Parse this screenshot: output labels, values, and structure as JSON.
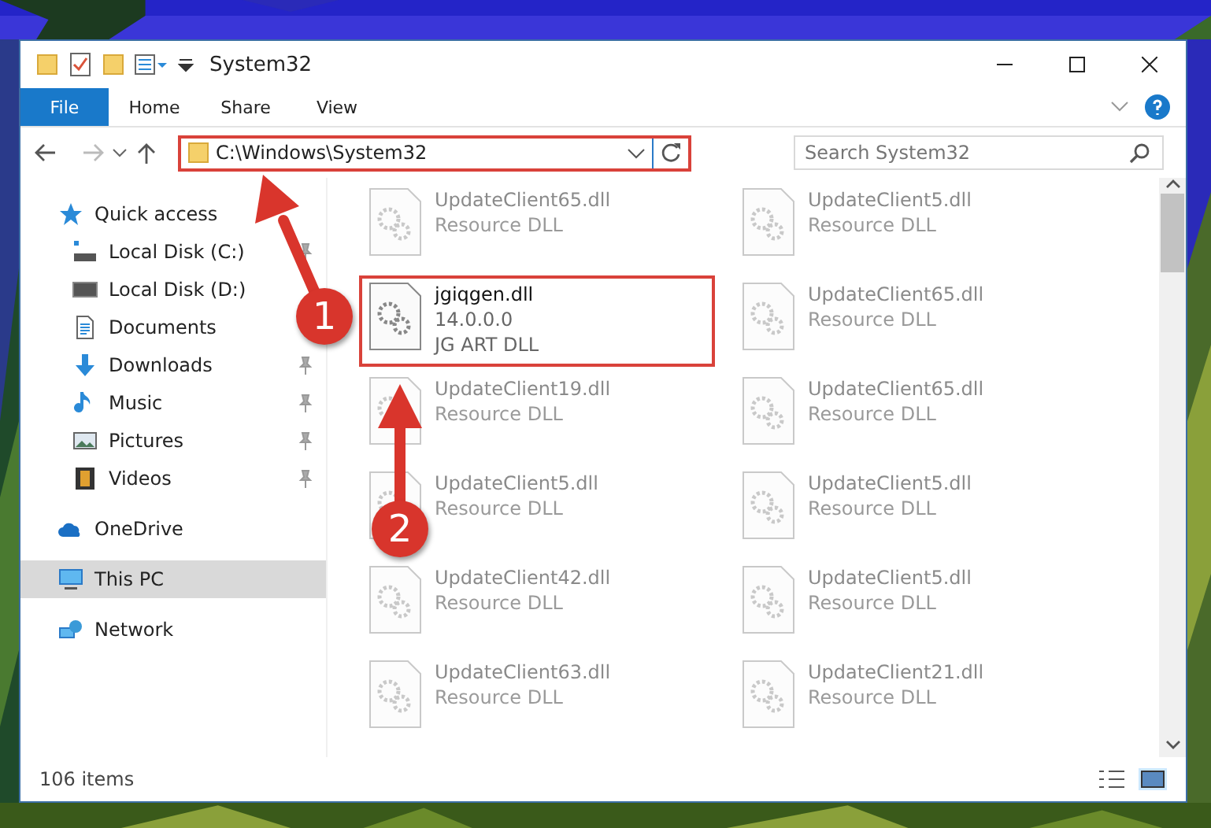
{
  "window": {
    "title": "System32"
  },
  "ribbon_tabs": [
    {
      "label": "File",
      "kind": "file",
      "selected": false
    },
    {
      "label": "Home",
      "kind": "tab",
      "selected": false
    },
    {
      "label": "Share",
      "kind": "tab",
      "selected": false
    },
    {
      "label": "View",
      "kind": "tab",
      "selected": false
    }
  ],
  "address_bar": {
    "path": "C:\\Windows\\System32",
    "highlighted": true
  },
  "search": {
    "placeholder": "Search System32"
  },
  "sidebar": {
    "groups": [
      {
        "label": "Quick access",
        "kind": "star",
        "selected": false,
        "children": [
          {
            "label": "Local Disk (C:)",
            "kind": "drive-c",
            "pinned": true,
            "selected": false
          },
          {
            "label": "Local Disk (D:)",
            "kind": "drive",
            "pinned": false,
            "selected": false
          },
          {
            "label": "Documents",
            "kind": "documents",
            "pinned": false,
            "selected": false
          },
          {
            "label": "Downloads",
            "kind": "downloads",
            "pinned": true,
            "selected": false
          },
          {
            "label": "Music",
            "kind": "music",
            "pinned": true,
            "selected": false
          },
          {
            "label": "Pictures",
            "kind": "pictures",
            "pinned": true,
            "selected": false
          },
          {
            "label": "Videos",
            "kind": "videos",
            "pinned": true,
            "selected": false
          }
        ]
      },
      {
        "label": "OneDrive",
        "kind": "cloud",
        "selected": false
      },
      {
        "label": "This PC",
        "kind": "pc",
        "selected": true
      },
      {
        "label": "Network",
        "kind": "network",
        "selected": false
      }
    ]
  },
  "files": [
    {
      "name": "UpdateClient65.dll",
      "lines": [
        "Resource DLL"
      ],
      "blurred": true,
      "highlighted": false
    },
    {
      "name": "UpdateClient5.dll",
      "lines": [
        "Resource DLL"
      ],
      "blurred": true,
      "highlighted": false
    },
    {
      "name": "jgiqgen.dll",
      "lines": [
        "14.0.0.0",
        "JG ART DLL"
      ],
      "blurred": false,
      "highlighted": true
    },
    {
      "name": "UpdateClient65.dll",
      "lines": [
        "Resource DLL"
      ],
      "blurred": true,
      "highlighted": false
    },
    {
      "name": "UpdateClient19.dll",
      "lines": [
        "Resource DLL"
      ],
      "blurred": true,
      "highlighted": false
    },
    {
      "name": "UpdateClient65.dll",
      "lines": [
        "Resource DLL"
      ],
      "blurred": true,
      "highlighted": false
    },
    {
      "name": "UpdateClient5.dll",
      "lines": [
        "Resource DLL"
      ],
      "blurred": true,
      "highlighted": false
    },
    {
      "name": "UpdateClient5.dll",
      "lines": [
        "Resource DLL"
      ],
      "blurred": true,
      "highlighted": false
    },
    {
      "name": "UpdateClient42.dll",
      "lines": [
        "Resource DLL"
      ],
      "blurred": true,
      "highlighted": false
    },
    {
      "name": "UpdateClient5.dll",
      "lines": [
        "Resource DLL"
      ],
      "blurred": true,
      "highlighted": false
    },
    {
      "name": "UpdateClient63.dll",
      "lines": [
        "Resource DLL"
      ],
      "blurred": true,
      "highlighted": false
    },
    {
      "name": "UpdateClient21.dll",
      "lines": [
        "Resource DLL"
      ],
      "blurred": true,
      "highlighted": false
    }
  ],
  "annotations": [
    {
      "number": "1"
    },
    {
      "number": "2"
    }
  ],
  "status_bar": {
    "item_count": "106 items"
  }
}
